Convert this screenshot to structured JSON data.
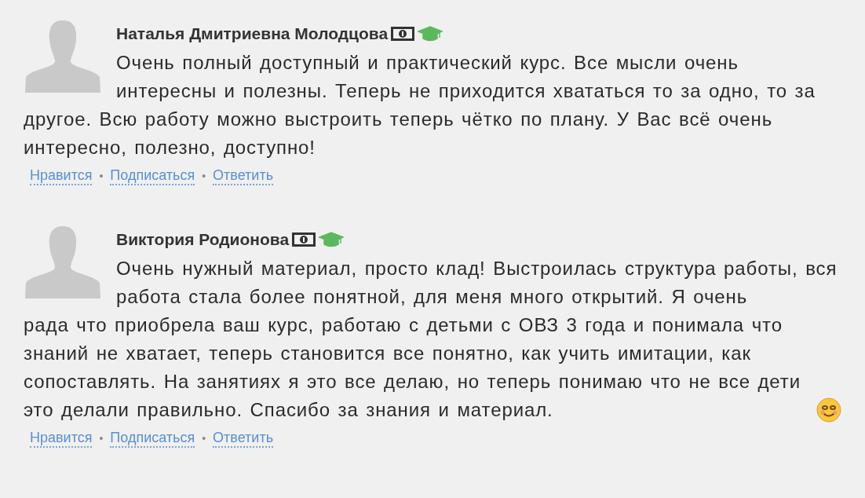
{
  "separator": "•",
  "comments": [
    {
      "author": "Наталья Дмитриевна Молодцова",
      "badges": [
        {
          "kind": "bill"
        },
        {
          "kind": "graduation"
        }
      ],
      "text": [
        "Очень полный доступный и практический курс. Все мысли очень интересны и полезны. Теперь не приходится хвататься то за одно, то за",
        "другое. Всю работу можно выстроить теперь чётко по плану. У Вас всё очень интересно, полезно, доступно!"
      ],
      "smiley": false,
      "actions": [
        "Нравится",
        "Подписаться",
        "Ответить"
      ]
    },
    {
      "author": "Виктория Родионова",
      "badges": [
        {
          "kind": "bill"
        },
        {
          "kind": "graduation"
        }
      ],
      "text": [
        "Очень нужный материал, просто клад! Выстроилась структура работы, вся работа стала более понятной, для меня много открытий. Я очень",
        "рада что приобрела ваш курс, работаю с детьми с ОВЗ 3 года и понимала что знаний не хватает, теперь становится все понятно, как учить имитации, как сопоставлять. На занятиях я это все делаю, но теперь понимаю что не все дети это делали правильно. Спасибо за знания и материал."
      ],
      "smiley": true,
      "actions": [
        "Нравится",
        "Подписаться",
        "Ответить"
      ]
    }
  ]
}
